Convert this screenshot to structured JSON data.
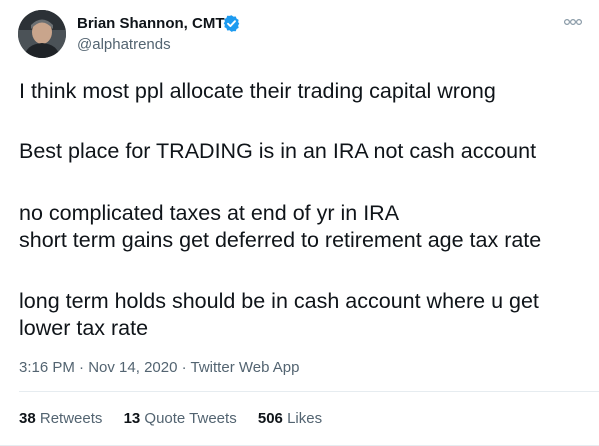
{
  "author": {
    "name": "Brian Shannon, CMT",
    "handle": "@alphatrends"
  },
  "tweet": {
    "lines": [
      "I think most ppl allocate their trading capital wrong",
      "Best place for TRADING is in an IRA not cash account",
      "no complicated taxes at end of yr in IRA",
      "short term gains get deferred to retirement age tax rate",
      "long term holds should be in cash account where u get",
      "lower tax rate"
    ]
  },
  "meta": {
    "time": "3:16 PM",
    "separator1": " · ",
    "date": "Nov 14, 2020",
    "separator2": " · ",
    "source": "Twitter Web App"
  },
  "stats": {
    "retweets_count": "38",
    "retweets_label": " Retweets",
    "quote_count": "13",
    "quote_label": " Quote Tweets",
    "likes_count": "506",
    "likes_label": " Likes"
  },
  "colors": {
    "verified": "#1d9bf0",
    "secondary_text": "#536471",
    "primary_text": "#0f1419"
  },
  "icons": {
    "verified": "verified-badge-icon",
    "more": "more-options-icon"
  }
}
